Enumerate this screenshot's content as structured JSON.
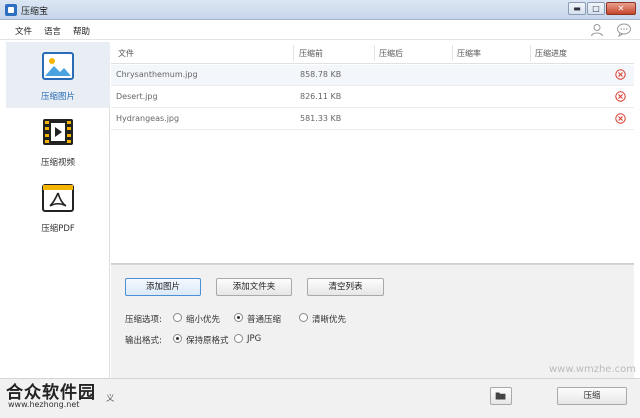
{
  "window": {
    "title": "压缩宝",
    "minimize": "▬",
    "maximize": "□",
    "close": "✕"
  },
  "menu": {
    "items": [
      "文件",
      "语言",
      "帮助"
    ]
  },
  "sidebar": {
    "items": [
      {
        "label": "压缩图片",
        "icon": "image-icon",
        "active": true
      },
      {
        "label": "压缩视频",
        "icon": "film-icon",
        "active": false
      },
      {
        "label": "压缩PDF",
        "icon": "pdf-icon",
        "active": false
      }
    ]
  },
  "table": {
    "headers": [
      "文件",
      "压缩前",
      "压缩后",
      "压缩率",
      "压缩进度"
    ],
    "rows": [
      {
        "file": "Chrysanthemum.jpg",
        "before": "858.78 KB"
      },
      {
        "file": "Desert.jpg",
        "before": "826.11 KB"
      },
      {
        "file": "Hydrangeas.jpg",
        "before": "581.33 KB"
      }
    ]
  },
  "controls": {
    "add_image": "添加图片",
    "add_folder": "添加文件夹",
    "clear_list": "清空列表",
    "compress_option_label": "压缩选项:",
    "compress_options": [
      {
        "label": "缩小优先",
        "selected": false
      },
      {
        "label": "普通压缩",
        "selected": true
      },
      {
        "label": "清晰优先",
        "selected": false
      }
    ],
    "output_format_label": "输出格式:",
    "output_formats": [
      {
        "label": "保持原格式",
        "selected": true
      },
      {
        "label": "JPG",
        "selected": false
      }
    ]
  },
  "footer": {
    "text": "义",
    "compress_button": "压缩"
  },
  "watermarks": {
    "hezhong_logo": "合众软件园",
    "hezhong_url": "www.hezhong.net",
    "wmzhe": "www.wmzhe.com"
  },
  "colors": {
    "accent": "#2a6db6",
    "delete_red": "#d9382c",
    "active_bg": "#e9eef4"
  }
}
